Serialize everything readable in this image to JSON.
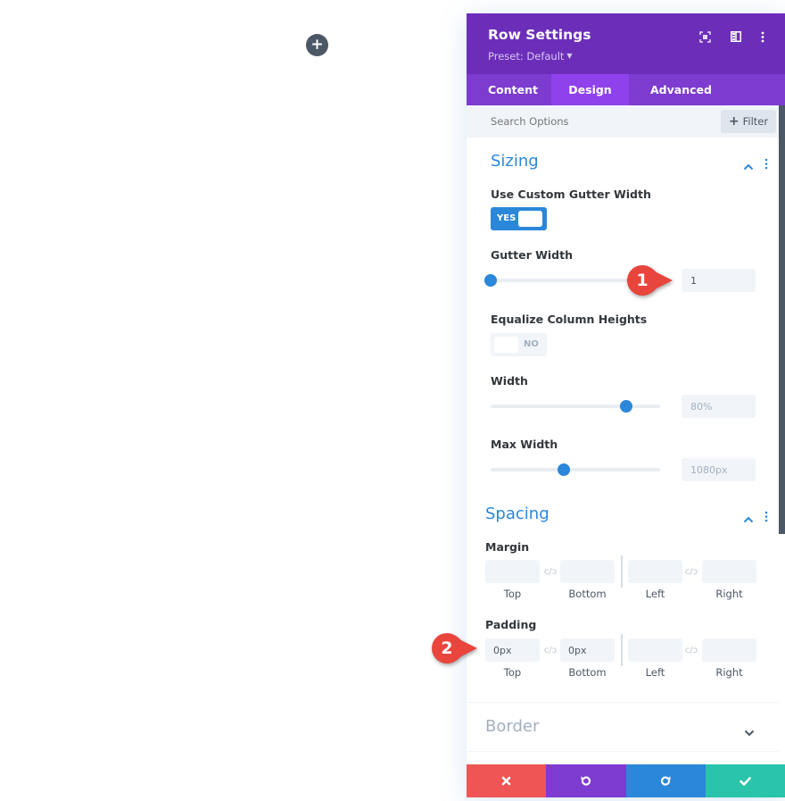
{
  "canvas": {
    "add_row_icon": "plus-icon"
  },
  "panel": {
    "title": "Row Settings",
    "preset_label": "Preset: Default",
    "header_icons": [
      "fullscreen-icon",
      "split-view-icon",
      "more-options-icon"
    ],
    "tabs": [
      {
        "label": "Content",
        "active": false
      },
      {
        "label": "Design",
        "active": true
      },
      {
        "label": "Advanced",
        "active": false
      }
    ],
    "search": {
      "placeholder": "Search Options",
      "filter_label": "Filter"
    },
    "sections": {
      "sizing": {
        "title": "Sizing",
        "expanded": true,
        "custom_gutter": {
          "label": "Use Custom Gutter Width",
          "value": "YES",
          "on": true
        },
        "gutter_width": {
          "label": "Gutter Width",
          "value": "1",
          "slider_fraction": 0
        },
        "equalize": {
          "label": "Equalize Column Heights",
          "value": "NO",
          "on": false
        },
        "width": {
          "label": "Width",
          "value": "80%",
          "slider_fraction": 0.8
        },
        "max_width": {
          "label": "Max Width",
          "value": "1080px",
          "slider_fraction": 0.43
        }
      },
      "spacing": {
        "title": "Spacing",
        "expanded": true,
        "margin": {
          "label": "Margin",
          "fields": [
            {
              "label": "Top",
              "value": ""
            },
            {
              "label": "Bottom",
              "value": ""
            },
            {
              "label": "Left",
              "value": ""
            },
            {
              "label": "Right",
              "value": ""
            }
          ]
        },
        "padding": {
          "label": "Padding",
          "fields": [
            {
              "label": "Top",
              "value": "0px"
            },
            {
              "label": "Bottom",
              "value": "0px"
            },
            {
              "label": "Left",
              "value": ""
            },
            {
              "label": "Right",
              "value": ""
            }
          ]
        }
      },
      "border": {
        "title": "Border",
        "expanded": false
      }
    },
    "footer": {
      "buttons": [
        "cancel",
        "undo",
        "redo",
        "save"
      ]
    }
  },
  "callouts": [
    {
      "number": "1",
      "target": "gutter-width-input"
    },
    {
      "number": "2",
      "target": "padding-top-input"
    }
  ],
  "colors": {
    "header_purple": "#6c2eb9",
    "tab_active": "#8f42ec",
    "accent_blue": "#2b87da",
    "cancel_red": "#ef5555",
    "undo_purple": "#7e3bd0",
    "save_teal": "#29c4a9",
    "callout_red": "#e8453c"
  }
}
